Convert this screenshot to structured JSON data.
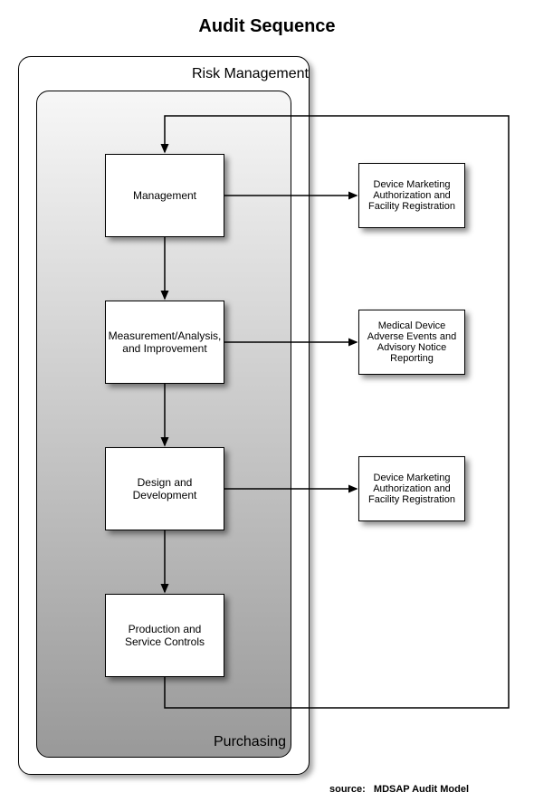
{
  "title": "Audit Sequence",
  "outer_label": "Risk Management",
  "inner_label": "Purchasing",
  "main_nodes": {
    "n1": "Management",
    "n2": "Measurement/Analysis, and Improvement",
    "n3": "Design and Development",
    "n4": "Production and Service Controls"
  },
  "side_nodes": {
    "s1": "Device Marketing Authorization and Facility Registration",
    "s2": "Medical Device Adverse Events and Advisory Notice Reporting",
    "s3": "Device Marketing Authorization and Facility Registration"
  },
  "source_label": "source:",
  "source_text": "MDSAP Audit Model"
}
